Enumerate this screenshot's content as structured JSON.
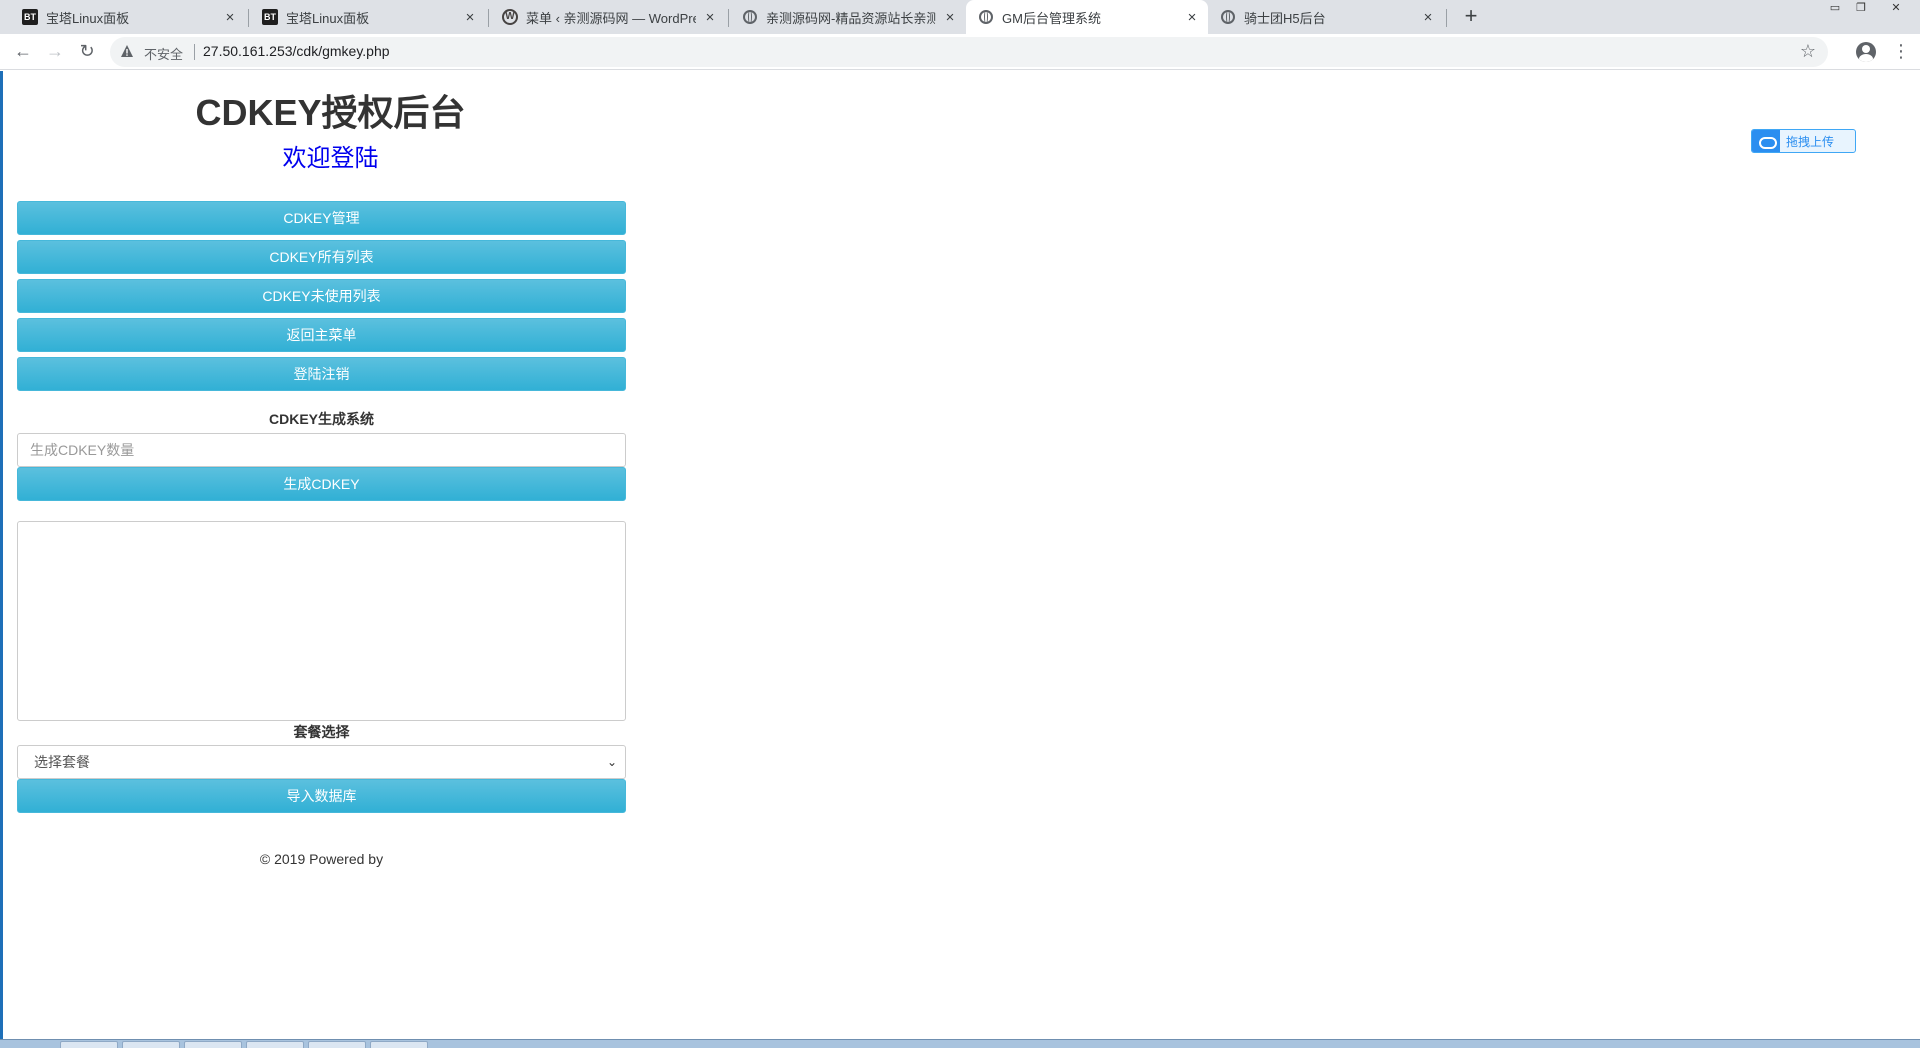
{
  "browser": {
    "tabs": [
      {
        "title": "宝塔Linux面板",
        "icon": "bt-icon",
        "active": false
      },
      {
        "title": "宝塔Linux面板",
        "icon": "bt-icon",
        "active": false
      },
      {
        "title": "菜单 ‹ 亲测源码网 — WordPress",
        "icon": "wordpress-icon",
        "active": false
      },
      {
        "title": "亲测源码网-精品资源站长亲测",
        "icon": "globe-icon",
        "active": false
      },
      {
        "title": "GM后台管理系统",
        "icon": "globe-icon",
        "active": true
      },
      {
        "title": "骑士团H5后台",
        "icon": "globe-icon",
        "active": false
      }
    ],
    "bt_favicon_text": "BT",
    "wp_favicon_text": "W",
    "close_glyph": "×",
    "new_tab_glyph": "+",
    "security_label": "不安全",
    "url": "27.50.161.253/cdk/gmkey.php"
  },
  "page": {
    "title": "CDKEY授权后台",
    "welcome": "欢迎登陆",
    "menu_buttons": [
      "CDKEY管理",
      "CDKEY所有列表",
      "CDKEY未使用列表",
      "返回主菜单",
      "登陆注销"
    ],
    "generator": {
      "label": "CDKEY生成系统",
      "placeholder": "生成CDKEY数量",
      "button": "生成CDKEY",
      "output": ""
    },
    "package": {
      "label": "套餐选择",
      "selected": "选择套餐",
      "import_button": "导入数据库"
    },
    "footer": "© 2019 Powered by"
  },
  "upload_widget": {
    "label": "拖拽上传"
  },
  "colors": {
    "button_bg": "#5bc0de",
    "button_border": "#46b8da",
    "welcome_text": "#0000ee",
    "tabstrip": "#dee1e6"
  }
}
